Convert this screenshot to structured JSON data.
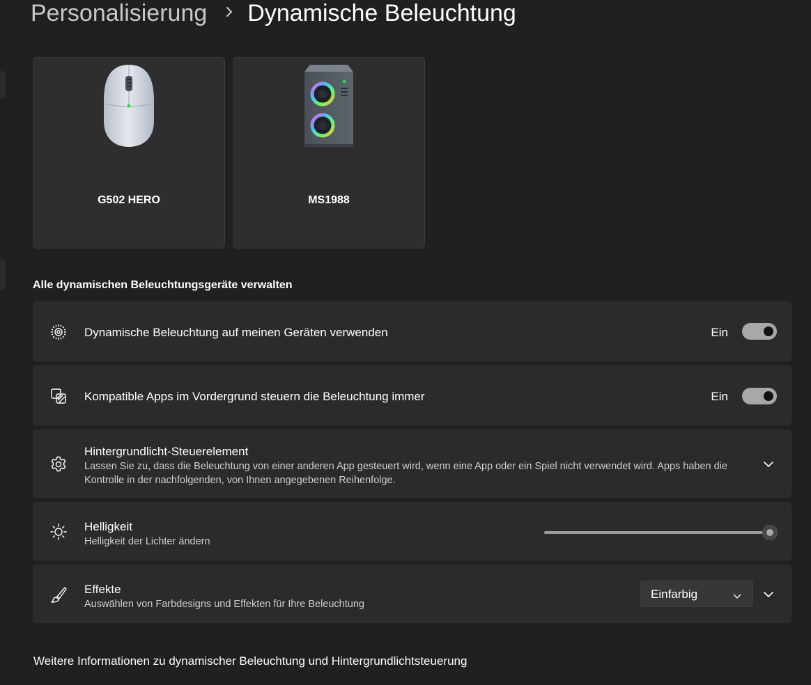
{
  "breadcrumb": {
    "parent": "Personalisierung",
    "current": "Dynamische Beleuchtung"
  },
  "devices": [
    {
      "name": "G502 HERO",
      "icon": "mouse-icon"
    },
    {
      "name": "MS1988",
      "icon": "pc-case-icon"
    }
  ],
  "section": {
    "title": "Alle dynamischen Beleuchtungsgeräte verwalten"
  },
  "settings": {
    "use_dynamic_lighting": {
      "title": "Dynamische Beleuchtung auf meinen Geräten verwenden",
      "state_label": "Ein",
      "on": true,
      "icon": "lighting-icon"
    },
    "foreground_apps": {
      "title": "Kompatible Apps im Vordergrund steuern die Beleuchtung immer",
      "state_label": "Ein",
      "on": true,
      "icon": "apps-lighting-icon"
    },
    "background_control": {
      "title": "Hintergrundlicht-Steuerelement",
      "description": "Lassen Sie zu, dass die Beleuchtung von einer anderen App gesteuert wird, wenn eine App oder ein Spiel nicht verwendet wird. Apps haben die Kontrolle in der nachfolgenden, von Ihnen angegebenen Reihenfolge.",
      "icon": "gear-icon"
    },
    "brightness": {
      "title": "Helligkeit",
      "description": "Helligkeit der Lichter ändern",
      "value_percent": 100,
      "icon": "sun-icon"
    },
    "effects": {
      "title": "Effekte",
      "description": "Auswählen von Farbdesigns und Effekten für Ihre Beleuchtung",
      "selected": "Einfarbig",
      "icon": "brush-icon"
    }
  },
  "footer": {
    "link": "Weitere Informationen zu dynamischer Beleuchtung und Hintergrundlichtsteuerung"
  },
  "colors": {
    "background": "#202020",
    "card": "#2b2b2b",
    "toggle_on": "#a8a8a8"
  }
}
